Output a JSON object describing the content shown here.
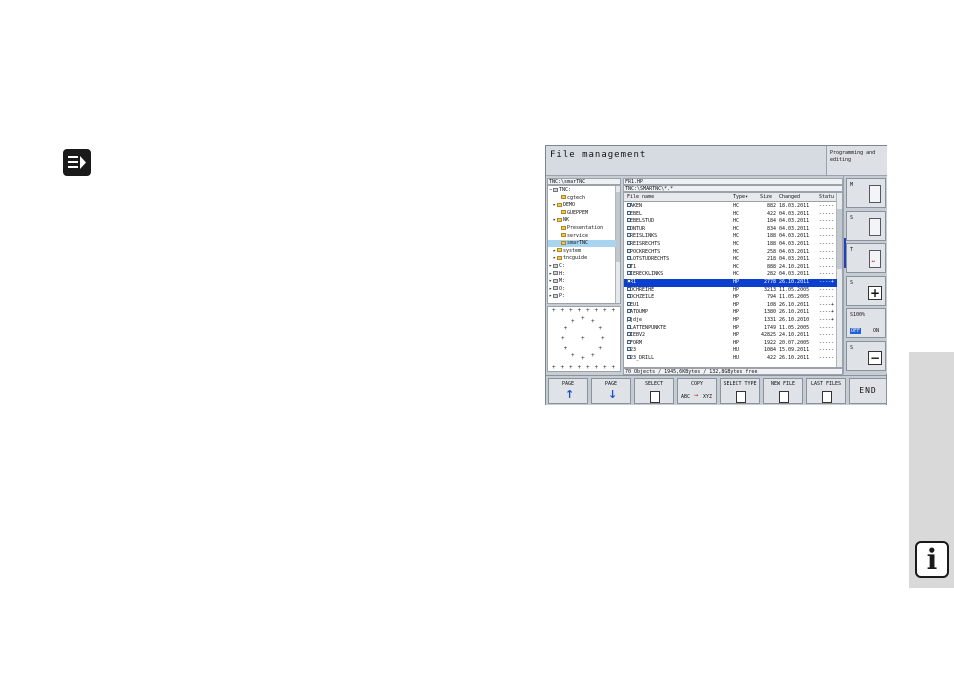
{
  "app_title": "File management",
  "mode_label": "Programming and editing",
  "tree": {
    "path": "TNC:\\smarTNC",
    "items": [
      {
        "label": "TNC:",
        "indent": 0,
        "kind": "drive",
        "expander": "−"
      },
      {
        "label": "cgtech",
        "indent": 2,
        "kind": "folder",
        "expander": ""
      },
      {
        "label": "DEMO",
        "indent": 1,
        "kind": "folder",
        "expander": "▸"
      },
      {
        "label": "GUEPPEM",
        "indent": 2,
        "kind": "folder",
        "expander": ""
      },
      {
        "label": "NK",
        "indent": 1,
        "kind": "folder",
        "expander": "▸"
      },
      {
        "label": "Presentation",
        "indent": 2,
        "kind": "folder",
        "expander": ""
      },
      {
        "label": "service",
        "indent": 2,
        "kind": "folder",
        "expander": ""
      },
      {
        "label": "smarTNC",
        "indent": 2,
        "kind": "folder",
        "expander": "",
        "selected": true
      },
      {
        "label": "system",
        "indent": 1,
        "kind": "folder",
        "expander": "▸"
      },
      {
        "label": "tncguide",
        "indent": 1,
        "kind": "folder",
        "expander": "▸"
      },
      {
        "label": "C:",
        "indent": 0,
        "kind": "drive",
        "expander": "▸"
      },
      {
        "label": "H:",
        "indent": 0,
        "kind": "drive",
        "expander": "▸"
      },
      {
        "label": "M:",
        "indent": 0,
        "kind": "drive",
        "expander": "▸"
      },
      {
        "label": "O:",
        "indent": 0,
        "kind": "drive",
        "expander": "▸"
      },
      {
        "label": "P:",
        "indent": 0,
        "kind": "drive",
        "expander": "▸"
      }
    ]
  },
  "preview_glyph": "+",
  "files": {
    "current_file": "FR1.HP",
    "path": "TNC:\\SMARTNC\\*.*",
    "columns": {
      "name": "File name",
      "type": "Type▾",
      "size": "Size",
      "changed": "Changed",
      "status": "Statu"
    },
    "rows": [
      {
        "name": "HAKEN",
        "type": "HC",
        "size": "882",
        "changed": "18.03.2011",
        "status": "-----"
      },
      {
        "name": "HEBEL",
        "type": "HC",
        "size": "422",
        "changed": "04.03.2011",
        "status": "-----"
      },
      {
        "name": "HEBELSTUD",
        "type": "HC",
        "size": "184",
        "changed": "04.03.2011",
        "status": "-----"
      },
      {
        "name": "KONTUR",
        "type": "HC",
        "size": "834",
        "changed": "04.03.2011",
        "status": "-----"
      },
      {
        "name": "KREISLINKS",
        "type": "HC",
        "size": "188",
        "changed": "04.03.2011",
        "status": "-----"
      },
      {
        "name": "KREISRECHTS",
        "type": "HC",
        "size": "188",
        "changed": "04.03.2011",
        "status": "-----"
      },
      {
        "name": "RPOCKRECHTS",
        "type": "HC",
        "size": "258",
        "changed": "04.03.2011",
        "status": "-----"
      },
      {
        "name": "SLOTSTUDRECHTS",
        "type": "HC",
        "size": "218",
        "changed": "04.03.2011",
        "status": "-----"
      },
      {
        "name": "ST1",
        "type": "HC",
        "size": "888",
        "changed": "24.10.2011",
        "status": "-----"
      },
      {
        "name": "VIERECKLINKS",
        "type": "HC",
        "size": "282",
        "changed": "04.03.2011",
        "status": "-----"
      },
      {
        "name": "FR1",
        "type": "HP",
        "size": "2778",
        "changed": "26.10.2011",
        "status": "----+",
        "selected": true
      },
      {
        "name": "LOCHREIHE",
        "type": "HP",
        "size": "3213",
        "changed": "11.05.2005",
        "status": "-----"
      },
      {
        "name": "LOCHZEILE",
        "type": "HP",
        "size": "794",
        "changed": "11.05.2005",
        "status": "-----"
      },
      {
        "name": "NEU1",
        "type": "HP",
        "size": "108",
        "changed": "26.10.2011",
        "status": "----+"
      },
      {
        "name": "PATDUMP",
        "type": "HP",
        "size": "1380",
        "changed": "26.10.2011",
        "status": "----+"
      },
      {
        "name": "pjdje",
        "type": "HP",
        "size": "1331",
        "changed": "26.10.2010",
        "status": "----+"
      },
      {
        "name": "PLATTENPUNKTE",
        "type": "HP",
        "size": "1749",
        "changed": "11.05.2005",
        "status": "-----"
      },
      {
        "name": "SIEBV2",
        "type": "HP",
        "size": "42825",
        "changed": "24.10.2011",
        "status": "-----"
      },
      {
        "name": "VFORM",
        "type": "HP",
        "size": "1922",
        "changed": "20.07.2005",
        "status": "-----"
      },
      {
        "name": "123",
        "type": "HU",
        "size": "1084",
        "changed": "15.09.2011",
        "status": "-----"
      },
      {
        "name": "123_DRILL",
        "type": "HU",
        "size": "422",
        "changed": "26.10.2011",
        "status": "-----"
      }
    ],
    "status_line": "70 Objects / 1945,6KBytes / 132,8GBytes free"
  },
  "right_bar": {
    "buttons": [
      {
        "label": "M",
        "kind": "glyph"
      },
      {
        "label": "S",
        "kind": "glyph"
      },
      {
        "label": "T",
        "kind": "glyph",
        "arrow": "↔"
      },
      {
        "label": "S",
        "kind": "big",
        "big": "+"
      },
      {
        "label": "S100%",
        "kind": "switch",
        "off": "OFF",
        "on": "ON"
      },
      {
        "label": "S",
        "kind": "big",
        "big": "−"
      }
    ]
  },
  "softkeys": [
    {
      "label": "PAGE",
      "kind": "arrow",
      "glyph": "↑"
    },
    {
      "label": "PAGE",
      "kind": "arrow",
      "glyph": "↓"
    },
    {
      "label": "SELECT",
      "kind": "doc"
    },
    {
      "label": "COPY",
      "kind": "copy",
      "from": "ABC",
      "to": "XYZ"
    },
    {
      "label": "SELECT TYPE",
      "kind": "doc"
    },
    {
      "label": "NEW FILE",
      "kind": "doc"
    },
    {
      "label": "LAST FILES",
      "kind": "doc"
    },
    {
      "label": "END",
      "kind": "end"
    }
  ],
  "side_icon": "i"
}
